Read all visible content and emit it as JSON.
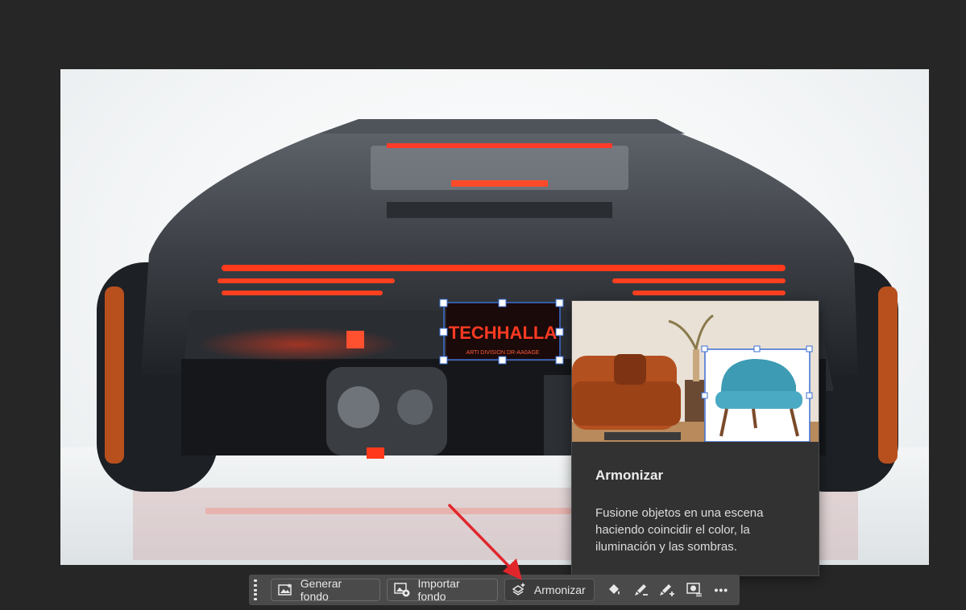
{
  "image": {
    "plate_text": "TECHHALLA",
    "plate_subtext": "ARTI DIVISION DR-AA0AGE"
  },
  "tooltip": {
    "title": "Armonizar",
    "description": "Fusione objetos en una escena haciendo coincidir el color, la iluminación y las sombras."
  },
  "taskbar": {
    "generate_bg_label": "Generar fondo",
    "import_bg_label": "Importar fondo",
    "harmonize_label": "Armonizar",
    "more_label": "•••"
  },
  "colors": {
    "app_bg": "#262626",
    "taskbar_bg": "#4a4a4a",
    "tooltip_bg": "#323232",
    "selection": "#3b6fd4",
    "annotation_arrow": "#e0262b",
    "taillight": "#ff2a10"
  },
  "icons": [
    "generate-background-icon",
    "import-background-icon",
    "harmonize-icon",
    "fill-bucket-icon",
    "brush-subtract-icon",
    "brush-add-icon",
    "mask-options-icon",
    "more-icon",
    "grip-icon"
  ]
}
